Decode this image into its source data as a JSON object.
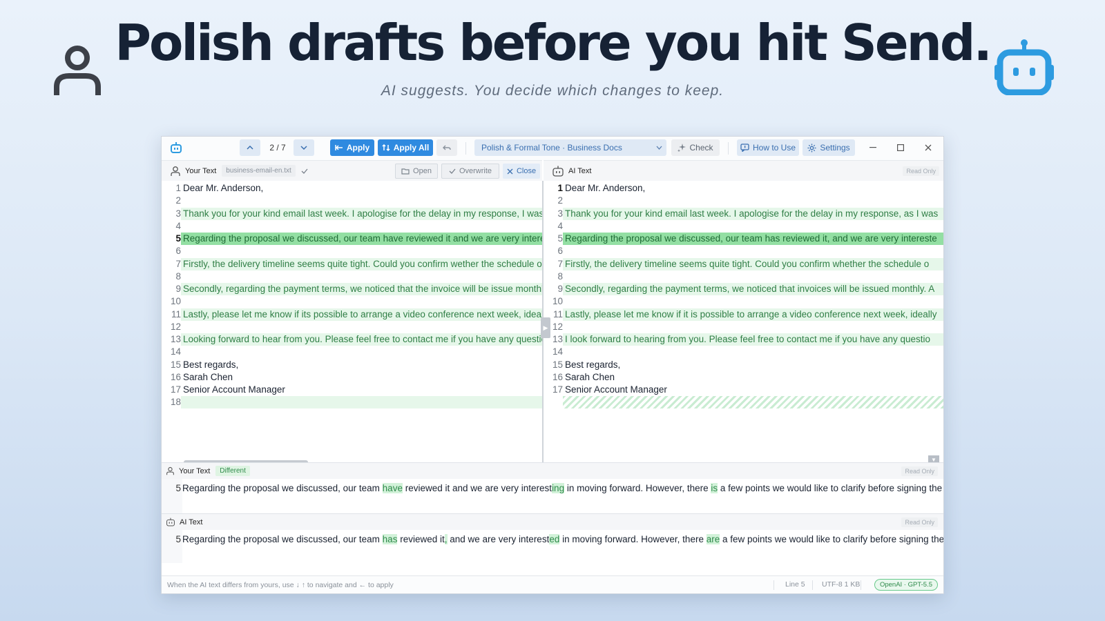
{
  "hero": {
    "title": "Polish drafts before you hit Send.",
    "subtitle": "AI suggests. You decide which changes to keep.",
    "left_icon": "user-icon",
    "right_icon": "robot-icon",
    "accent": "#2d9be0"
  },
  "toolbar": {
    "counter": "2 / 7",
    "apply_label": "Apply",
    "apply_all_label": "Apply All",
    "profile": "Polish & Formal Tone · Business Docs",
    "check_label": "Check",
    "how_to_use_label": "How to Use",
    "settings_label": "Settings"
  },
  "left_pane": {
    "label": "Your Text",
    "filename": "business-email-en.txt",
    "open_label": "Open",
    "overwrite_label": "Overwrite",
    "close_label": "Close",
    "lines": [
      {
        "n": "1",
        "text": "Dear Mr. Anderson,",
        "hl": ""
      },
      {
        "n": "2",
        "text": "",
        "hl": ""
      },
      {
        "n": "3",
        "text": "Thank you for your kind email last week. I apologise for the delay in my response, I was o",
        "hl": "light"
      },
      {
        "n": "4",
        "text": "",
        "hl": ""
      },
      {
        "n": "5",
        "text": "Regarding the proposal we discussed, our team have reviewed it and we are very interesti",
        "hl": "strong"
      },
      {
        "n": "6",
        "text": "",
        "hl": ""
      },
      {
        "n": "7",
        "text": "Firstly, the delivery timeline seems quite tight. Could you confirm wether the schedule on",
        "hl": "light"
      },
      {
        "n": "8",
        "text": "",
        "hl": ""
      },
      {
        "n": "9",
        "text": "Secondly, regarding the payment terms, we noticed that the invoice will be issue monthly.",
        "hl": "light"
      },
      {
        "n": "10",
        "text": "",
        "hl": ""
      },
      {
        "n": "11",
        "text": "Lastly, please let me know if its possible to arrange a video conference next week, ideally",
        "hl": "light"
      },
      {
        "n": "12",
        "text": "",
        "hl": ""
      },
      {
        "n": "13",
        "text": "Looking forward to hear from you. Please feel free to contact me if you have any questior",
        "hl": "light"
      },
      {
        "n": "14",
        "text": "",
        "hl": ""
      },
      {
        "n": "15",
        "text": "Best regards,",
        "hl": ""
      },
      {
        "n": "16",
        "text": "Sarah Chen",
        "hl": ""
      },
      {
        "n": "17",
        "text": "Senior Account Manager",
        "hl": ""
      },
      {
        "n": "18",
        "text": "",
        "hl": "blank"
      }
    ]
  },
  "right_pane": {
    "label": "AI Text",
    "read_only": "Read Only",
    "lines": [
      {
        "n": "1",
        "text": "Dear Mr. Anderson,",
        "hl": ""
      },
      {
        "n": "2",
        "text": "",
        "hl": ""
      },
      {
        "n": "3",
        "text": "Thank you for your kind email last week. I apologise for the delay in my response, as I was",
        "hl": "light"
      },
      {
        "n": "4",
        "text": "",
        "hl": ""
      },
      {
        "n": "5",
        "text": "Regarding the proposal we discussed, our team has reviewed it, and we are very intereste",
        "hl": "strong"
      },
      {
        "n": "6",
        "text": "",
        "hl": ""
      },
      {
        "n": "7",
        "text": "Firstly, the delivery timeline seems quite tight. Could you confirm whether the schedule o",
        "hl": "light"
      },
      {
        "n": "8",
        "text": "",
        "hl": ""
      },
      {
        "n": "9",
        "text": "Secondly, regarding the payment terms, we noticed that invoices will be issued monthly. A",
        "hl": "light"
      },
      {
        "n": "10",
        "text": "",
        "hl": ""
      },
      {
        "n": "11",
        "text": "Lastly, please let me know if it is possible to arrange a video conference next week, ideally",
        "hl": "light"
      },
      {
        "n": "12",
        "text": "",
        "hl": ""
      },
      {
        "n": "13",
        "text": "I look forward to hearing from you. Please feel free to contact me if you have any questio",
        "hl": "light"
      },
      {
        "n": "14",
        "text": "",
        "hl": ""
      },
      {
        "n": "15",
        "text": "Best regards,",
        "hl": ""
      },
      {
        "n": "16",
        "text": "Sarah Chen",
        "hl": ""
      },
      {
        "n": "17",
        "text": "Senior Account Manager",
        "hl": ""
      },
      {
        "n": "",
        "text": "",
        "hl": "hatch"
      }
    ]
  },
  "diff_your": {
    "label": "Your Text",
    "tag": "Different",
    "read_only": "Read Only",
    "line_no": "5",
    "segments": [
      {
        "t": "Regarding the proposal we discussed, our team ",
        "m": false
      },
      {
        "t": "have",
        "m": true
      },
      {
        "t": " reviewed it and we are very interest",
        "m": false
      },
      {
        "t": "ing",
        "m": true
      },
      {
        "t": " in moving forward. However, there ",
        "m": false
      },
      {
        "t": "is",
        "m": true
      },
      {
        "t": " a few points we would like to clarify before signing the",
        "m": false
      }
    ]
  },
  "diff_ai": {
    "label": "AI Text",
    "read_only": "Read Only",
    "line_no": "5",
    "segments": [
      {
        "t": "Regarding the proposal we discussed, our team ",
        "m": false
      },
      {
        "t": "has",
        "m": true
      },
      {
        "t": " reviewed it",
        "m": false
      },
      {
        "t": ",",
        "m": true
      },
      {
        "t": " and we are very interest",
        "m": false
      },
      {
        "t": "ed",
        "m": true
      },
      {
        "t": " in moving forward. However, there ",
        "m": false
      },
      {
        "t": "are",
        "m": true
      },
      {
        "t": " a few points we would like to clarify before signing the",
        "m": false
      }
    ]
  },
  "statusbar": {
    "hint": "When the AI text differs from yours, use ↓ ↑ to navigate and ← to apply",
    "line": "Line 5",
    "encoding": "UTF-8 1 KB",
    "model": "OpenAI · GPT-5.5"
  }
}
